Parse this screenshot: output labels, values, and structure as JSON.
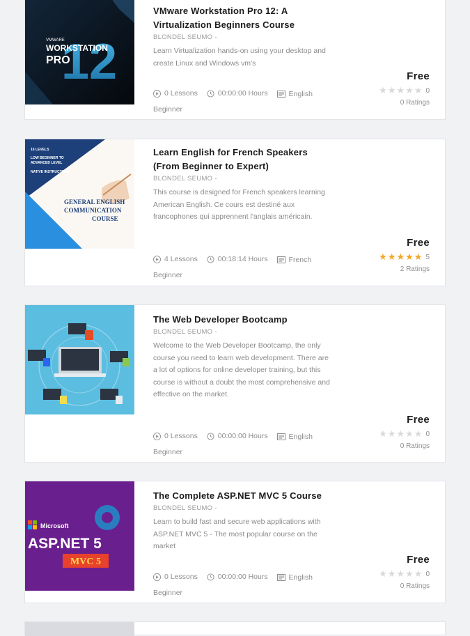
{
  "courses": [
    {
      "title": "VMware Workstation Pro 12: A Virtualization Beginners Course",
      "author": "BLONDEL SEUMO -",
      "description": "Learn Virtualization hands-on using your desktop and create Linux and Windows vm's",
      "lessons": "0 Lessons",
      "hours": "00:00:00 Hours",
      "language": "English",
      "level": "Beginner",
      "price": "Free",
      "rating_value": "0",
      "rating_stars": 0,
      "ratings_label": "0 Ratings",
      "thumb": {
        "brand": "VMWARE",
        "line1": "WORKSTATION",
        "line2": "PRO",
        "number": "12"
      }
    },
    {
      "title": "Learn English for French Speakers (From Beginner to Expert)",
      "author": "BLONDEL SEUMO -",
      "description": "This course is designed for French speakers learning American English. Ce cours est destiné aux francophones qui apprennent l'anglais américain.",
      "lessons": "4 Lessons",
      "hours": "00:18:14 Hours",
      "language": "French",
      "level": "Beginner",
      "price": "Free",
      "rating_value": "5",
      "rating_stars": 5,
      "ratings_label": "2 Ratings",
      "thumb": {
        "l1": "16 LEVELS",
        "l2": "LOW BEGINNER TO",
        "l3": "ADVANCED LEVEL",
        "l4": "NATIVE INSTRUCTORS",
        "t1": "GENERAL ENGLISH",
        "t2": "COMMUNICATION",
        "t3": "COURSE"
      }
    },
    {
      "title": "The Web Developer Bootcamp",
      "author": "BLONDEL SEUMO -",
      "description": "Welcome to the Web Developer Bootcamp, the only course you need to learn web development. There are a lot of options for online developer training, but this course is without a doubt the most comprehensive and effective on the market.",
      "lessons": "0 Lessons",
      "hours": "00:00:00 Hours",
      "language": "English",
      "level": "Beginner",
      "price": "Free",
      "rating_value": "0",
      "rating_stars": 0,
      "ratings_label": "0 Ratings"
    },
    {
      "title": "The Complete ASP.NET MVC 5 Course",
      "author": "BLONDEL SEUMO -",
      "description": "Learn to build fast and secure web applications with ASP.NET MVC 5 - The most popular course on the market",
      "lessons": "0 Lessons",
      "hours": "00:00:00 Hours",
      "language": "English",
      "level": "Beginner",
      "price": "Free",
      "rating_value": "0",
      "rating_stars": 0,
      "ratings_label": "0 Ratings",
      "thumb": {
        "brand": "Microsoft",
        "big": "ASP.NET 5",
        "tag": "MVC 5"
      }
    }
  ],
  "colors": {
    "star_on": "#f5a623",
    "star_off": "#d9d9d9",
    "asp_purple": "#6a1f8f",
    "vm_blue": "#1f8ec9"
  }
}
